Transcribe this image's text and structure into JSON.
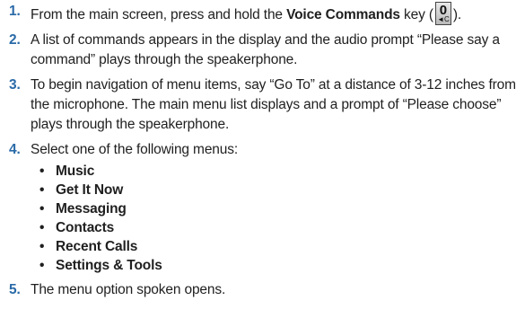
{
  "steps": [
    {
      "number": "1.",
      "pre": "From the main screen, press and hold the ",
      "bold": "Voice Commands",
      "post_a": " key (",
      "post_b": ")."
    },
    {
      "number": "2.",
      "text": "A list of commands appears in the display and the audio prompt “Please say a command” plays through the speakerphone."
    },
    {
      "number": "3.",
      "text": "To begin navigation of menu items, say “Go To” at a distance of 3-12 inches from the microphone. The main menu list displays and a prompt of “Please choose” plays through the speakerphone."
    },
    {
      "number": "4.",
      "text": "Select one of the following menus:"
    },
    {
      "number": "5.",
      "text": "The menu option spoken opens."
    }
  ],
  "menus": [
    "Music",
    "Get It Now",
    "Messaging",
    "Contacts",
    "Recent Calls",
    "Settings & Tools"
  ],
  "key_icon": {
    "name": "voice-commands-key-icon",
    "digit": "0",
    "sub": "◄C"
  },
  "colors": {
    "step_number": "#2a6aa8",
    "text": "#1f1f1f"
  }
}
